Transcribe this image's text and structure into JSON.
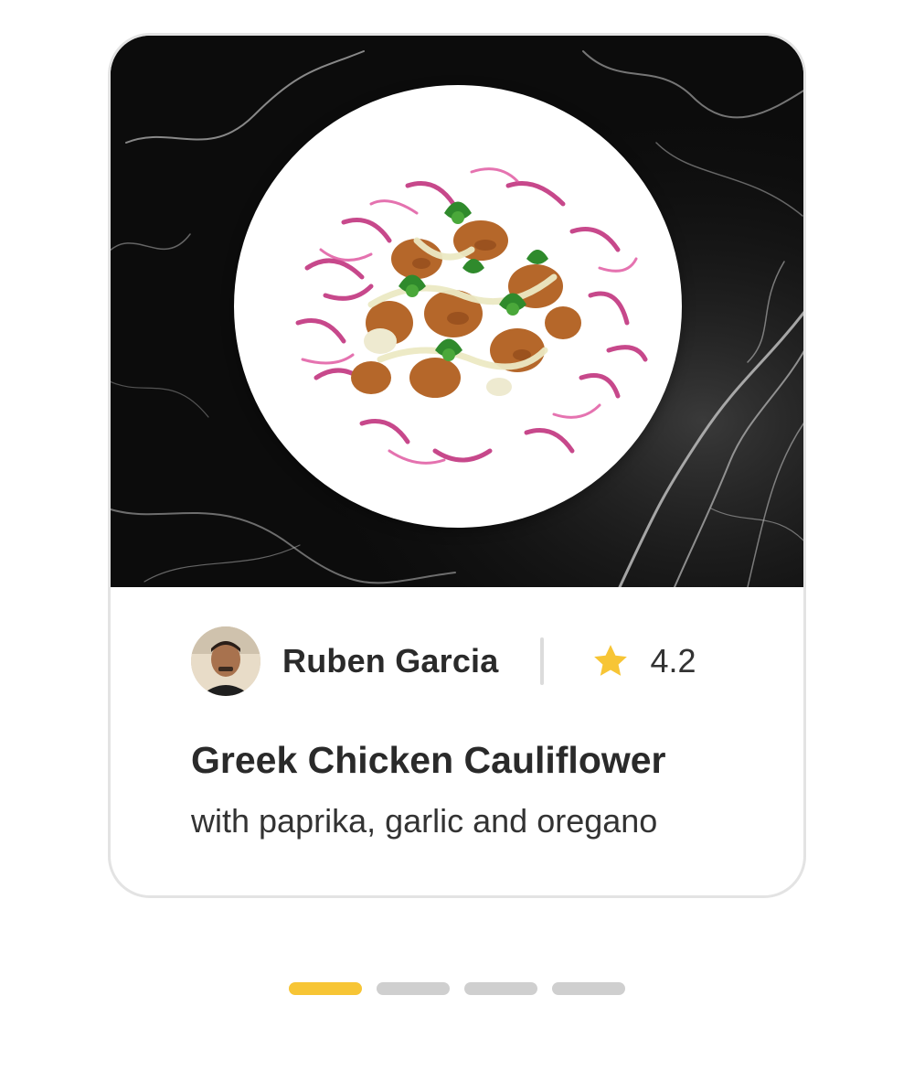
{
  "recipe": {
    "author_name": "Ruben Garcia",
    "rating": "4.2",
    "title": "Greek Chicken Cauliflower",
    "subtitle": "with paprika, garlic and oregano",
    "icons": {
      "rating": "star-icon",
      "author": "avatar"
    }
  },
  "pager": {
    "total_pages": 4,
    "active_index": 0
  },
  "colors": {
    "accent": "#f7c535",
    "inactive_dot": "#cfcfcf",
    "card_border": "#e3e3e3",
    "text_primary": "#2a2a2a"
  }
}
